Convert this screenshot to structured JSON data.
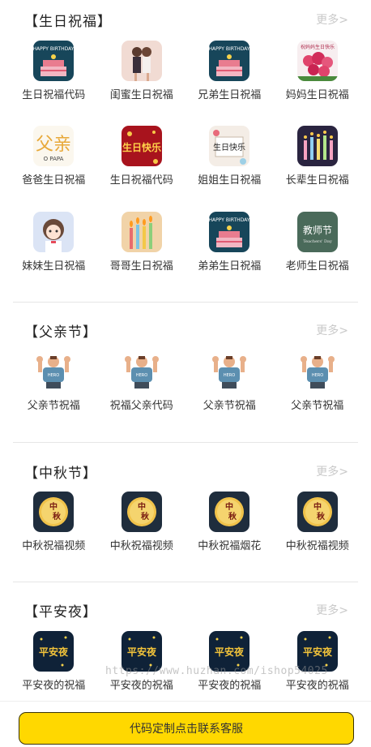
{
  "sections": [
    {
      "title": "【生日祝福】",
      "more": "更多>",
      "items": [
        {
          "label": "生日祝福代码",
          "icon": "birthday-cake-icon"
        },
        {
          "label": "闺蜜生日祝福",
          "icon": "two-girls-icon"
        },
        {
          "label": "兄弟生日祝福",
          "icon": "birthday-cake-icon"
        },
        {
          "label": "妈妈生日祝福",
          "icon": "roses-icon"
        },
        {
          "label": "爸爸生日祝福",
          "icon": "father-text-icon"
        },
        {
          "label": "生日祝福代码",
          "icon": "birthday-sign-icon"
        },
        {
          "label": "姐姐生日祝福",
          "icon": "birthday-card-icon"
        },
        {
          "label": "长辈生日祝福",
          "icon": "candles-icon"
        },
        {
          "label": "妹妹生日祝福",
          "icon": "anime-girl-icon"
        },
        {
          "label": "哥哥生日祝福",
          "icon": "candles-icon"
        },
        {
          "label": "弟弟生日祝福",
          "icon": "birthday-cake-icon"
        },
        {
          "label": "老师生日祝福",
          "icon": "teachers-day-icon"
        }
      ]
    },
    {
      "title": "【父亲节】",
      "more": "更多>",
      "items": [
        {
          "label": "父亲节祝福",
          "icon": "hero-dad-icon"
        },
        {
          "label": "祝福父亲代码",
          "icon": "hero-dad-icon"
        },
        {
          "label": "父亲节祝福",
          "icon": "hero-dad-icon"
        },
        {
          "label": "父亲节祝福",
          "icon": "hero-dad-icon"
        }
      ]
    },
    {
      "title": "【中秋节】",
      "more": "更多>",
      "items": [
        {
          "label": "中秋祝福视频",
          "icon": "moon-festival-icon"
        },
        {
          "label": "中秋祝福视频",
          "icon": "moon-festival-icon"
        },
        {
          "label": "中秋祝福烟花",
          "icon": "moon-festival-icon"
        },
        {
          "label": "中秋祝福视频",
          "icon": "moon-festival-icon"
        }
      ]
    },
    {
      "title": "【平安夜】",
      "more": "更多>",
      "items": [
        {
          "label": "平安夜的祝福",
          "icon": "christmas-eve-icon"
        },
        {
          "label": "平安夜的祝福",
          "icon": "christmas-eve-icon"
        },
        {
          "label": "平安夜的祝福",
          "icon": "christmas-eve-icon"
        },
        {
          "label": "平安夜的祝福",
          "icon": "christmas-eve-icon"
        }
      ]
    }
  ],
  "footer": {
    "cta_label": "代码定制点击联系客服"
  },
  "watermark": "https://www.huzhan.com/ishop54025",
  "colors": {
    "cta": "#ffd800",
    "more": "#c9c9c9",
    "divider": "#e6e6e6"
  }
}
